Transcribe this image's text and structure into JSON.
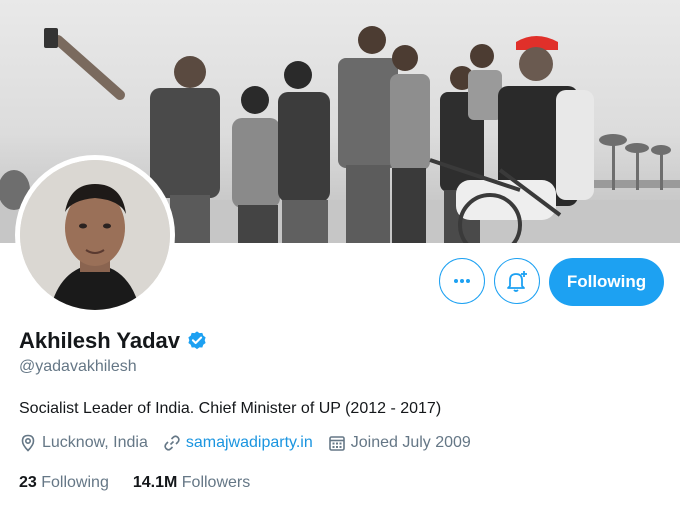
{
  "profile": {
    "name": "Akhilesh Yadav",
    "handle": "@yadavakhilesh",
    "bio": "Socialist Leader of India. Chief Minister of UP (2012 - 2017)",
    "location": "Lucknow, India",
    "website": "samajwadiparty.in",
    "joined": "Joined July 2009",
    "following_count": "23",
    "following_label": "Following",
    "followers_count": "14.1M",
    "followers_label": "Followers"
  },
  "actions": {
    "more_icon": "more-horizontal-icon",
    "notify_icon": "bell-plus-icon",
    "follow_label": "Following"
  },
  "colors": {
    "accent": "#1da1f2",
    "link": "#1b95e0",
    "secondary_text": "#657786"
  }
}
